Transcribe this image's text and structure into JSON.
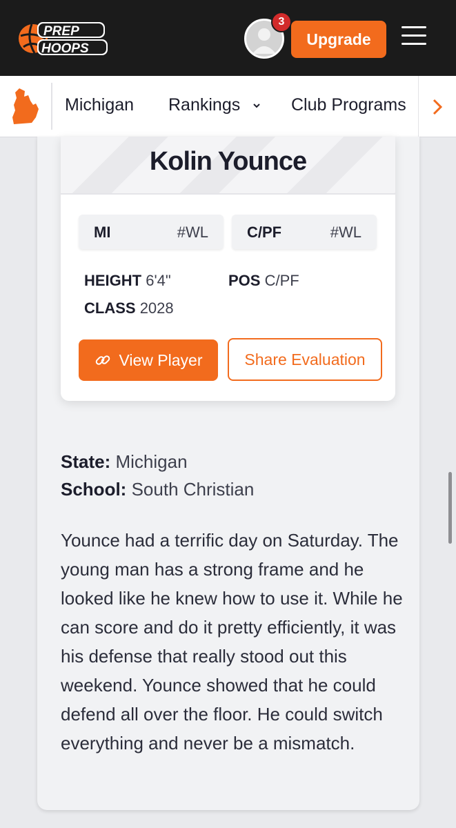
{
  "header": {
    "logo_text": "PREP HOOPS",
    "notification_count": "3",
    "upgrade_label": "Upgrade"
  },
  "subnav": {
    "state": "Michigan",
    "rankings": "Rankings",
    "club_programs": "Club Programs"
  },
  "player": {
    "name": "Kolin Younce",
    "state_abbr": "MI",
    "state_rank": "#WL",
    "position_abbr": "C/PF",
    "position_rank": "#WL",
    "height_label": "HEIGHT",
    "height_value": "6'4\"",
    "pos_label": "POS",
    "pos_value": "C/PF",
    "class_label": "CLASS",
    "class_value": "2028",
    "view_player_label": "View Player",
    "share_label": "Share Evaluation"
  },
  "details": {
    "state_label": "State:",
    "state_value": "Michigan",
    "school_label": "School:",
    "school_value": "South Christian"
  },
  "evaluation": "Younce had a terrific day on Saturday. The young man has a strong frame and he looked like he knew how to use it. While he can score and do it pretty efficiently, it was his defense that really stood out this weekend. Younce showed that he could defend all over the floor. He could switch everything and never be a mismatch.",
  "colors": {
    "brand_orange": "#f26b1d",
    "header_bg": "#1b1b1b",
    "badge_red": "#d22b2b"
  },
  "icons": {
    "logo": "prep-hoops-basketball-logo",
    "avatar": "user-avatar-icon",
    "menu": "hamburger-menu-icon",
    "state": "michigan-state-shape-icon",
    "chevron": "chevron-down-icon",
    "next": "chevron-right-icon",
    "link": "link-icon"
  }
}
